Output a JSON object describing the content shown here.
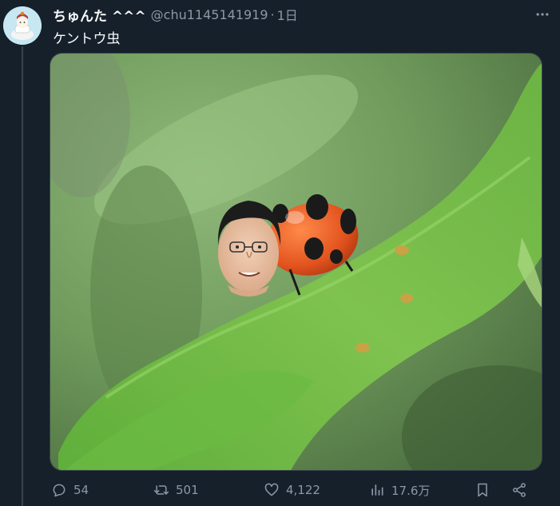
{
  "tweet": {
    "display_name": "ちゅんた ^^^",
    "handle": "@chu1145141919",
    "separator": "·",
    "time": "1日",
    "text": "ケントウ虫"
  },
  "media": {
    "alt_icons": [
      "leaf-image",
      "ladybug-image",
      "face-sticker-image"
    ]
  },
  "actions": {
    "replies": "54",
    "retweets": "501",
    "likes": "4,122",
    "views": "17.6万"
  },
  "colors": {
    "background": "#15202b",
    "text_primary": "#f7f9f9",
    "text_secondary": "#8b98a5",
    "border": "#38444d"
  }
}
